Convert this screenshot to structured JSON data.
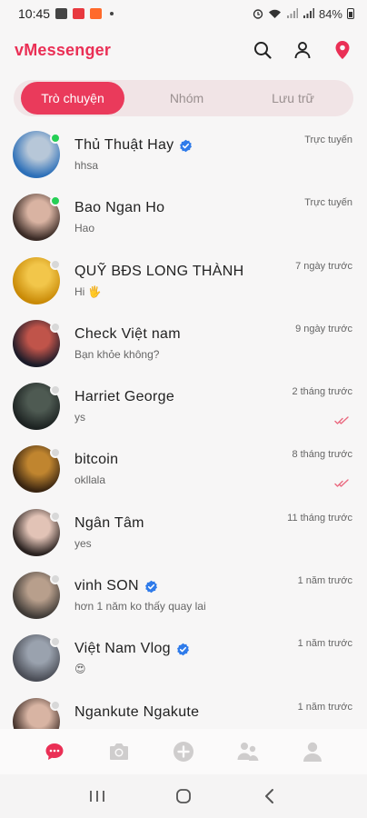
{
  "status_bar": {
    "time": "10:45",
    "battery": "84%",
    "icon_colors": [
      "#444444",
      "#e8393f",
      "#ff6a2b"
    ]
  },
  "app": {
    "title": "vMessenger",
    "accent": "#ea2f55",
    "actions": [
      "search-icon",
      "profile-icon",
      "location-pin-icon"
    ]
  },
  "tabs": [
    {
      "label": "Trò chuyện",
      "active": true
    },
    {
      "label": "Nhóm",
      "active": false
    },
    {
      "label": "Lưu trữ",
      "active": false
    }
  ],
  "conversations": [
    {
      "name": "Thủ Thuật Hay",
      "verified": true,
      "preview": "hhsa",
      "time": "Trực tuyến",
      "online": true,
      "read": false,
      "avatar_colors": [
        "#2c6fb8",
        "#b7c7d8"
      ]
    },
    {
      "name": "Bao Ngan Ho",
      "verified": false,
      "preview": "Hao",
      "time": "Trực tuyến",
      "online": true,
      "read": false,
      "avatar_colors": [
        "#3a2b26",
        "#d9b3a2"
      ]
    },
    {
      "name": "QUỸ BĐS LONG THÀNH",
      "verified": false,
      "preview": "Hi 🖐️",
      "time": "7 ngày trước",
      "online": false,
      "read": false,
      "avatar_colors": [
        "#c98a07",
        "#f2c64a"
      ]
    },
    {
      "name": "Check Việt nam",
      "verified": false,
      "preview": "Bạn khỏe không?",
      "time": "9 ngày trước",
      "online": false,
      "read": false,
      "avatar_colors": [
        "#1b1b28",
        "#c0544a"
      ]
    },
    {
      "name": "Harriet George",
      "verified": false,
      "preview": "ys",
      "time": "2 tháng trước",
      "online": false,
      "read": true,
      "avatar_colors": [
        "#1d2322",
        "#4e5a52"
      ]
    },
    {
      "name": "bitcoin",
      "verified": false,
      "preview": "okllala",
      "time": "8 tháng trước",
      "online": false,
      "read": true,
      "avatar_colors": [
        "#3a2511",
        "#c0852f"
      ]
    },
    {
      "name": "Ngân Tâm",
      "verified": false,
      "preview": "yes",
      "time": "11 tháng trước",
      "online": false,
      "read": false,
      "avatar_colors": [
        "#2a2220",
        "#e2c3b6"
      ]
    },
    {
      "name": "vinh SON",
      "verified": true,
      "preview": "hơn 1 năm ko thấy quay lai",
      "time": "1 năm trước",
      "online": false,
      "read": false,
      "avatar_colors": [
        "#3f3a36",
        "#b89f8c"
      ]
    },
    {
      "name": "Việt Nam Vlog",
      "verified": true,
      "preview": "😍",
      "time": "1 năm trước",
      "online": false,
      "read": false,
      "avatar_colors": [
        "#4b4e57",
        "#9aa2ae"
      ]
    },
    {
      "name": "Ngankute Ngakute",
      "verified": false,
      "preview": "",
      "time": "1 năm trước",
      "online": false,
      "read": false,
      "avatar_colors": [
        "#3b2a24",
        "#d8b4a3"
      ]
    }
  ],
  "bottom_nav": [
    {
      "icon": "chat-bubble-icon",
      "active": true
    },
    {
      "icon": "camera-icon",
      "active": false
    },
    {
      "icon": "add-circle-icon",
      "active": false
    },
    {
      "icon": "contacts-icon",
      "active": false
    },
    {
      "icon": "user-icon",
      "active": false
    }
  ],
  "system_nav": [
    "recents-icon",
    "home-icon",
    "back-icon"
  ]
}
